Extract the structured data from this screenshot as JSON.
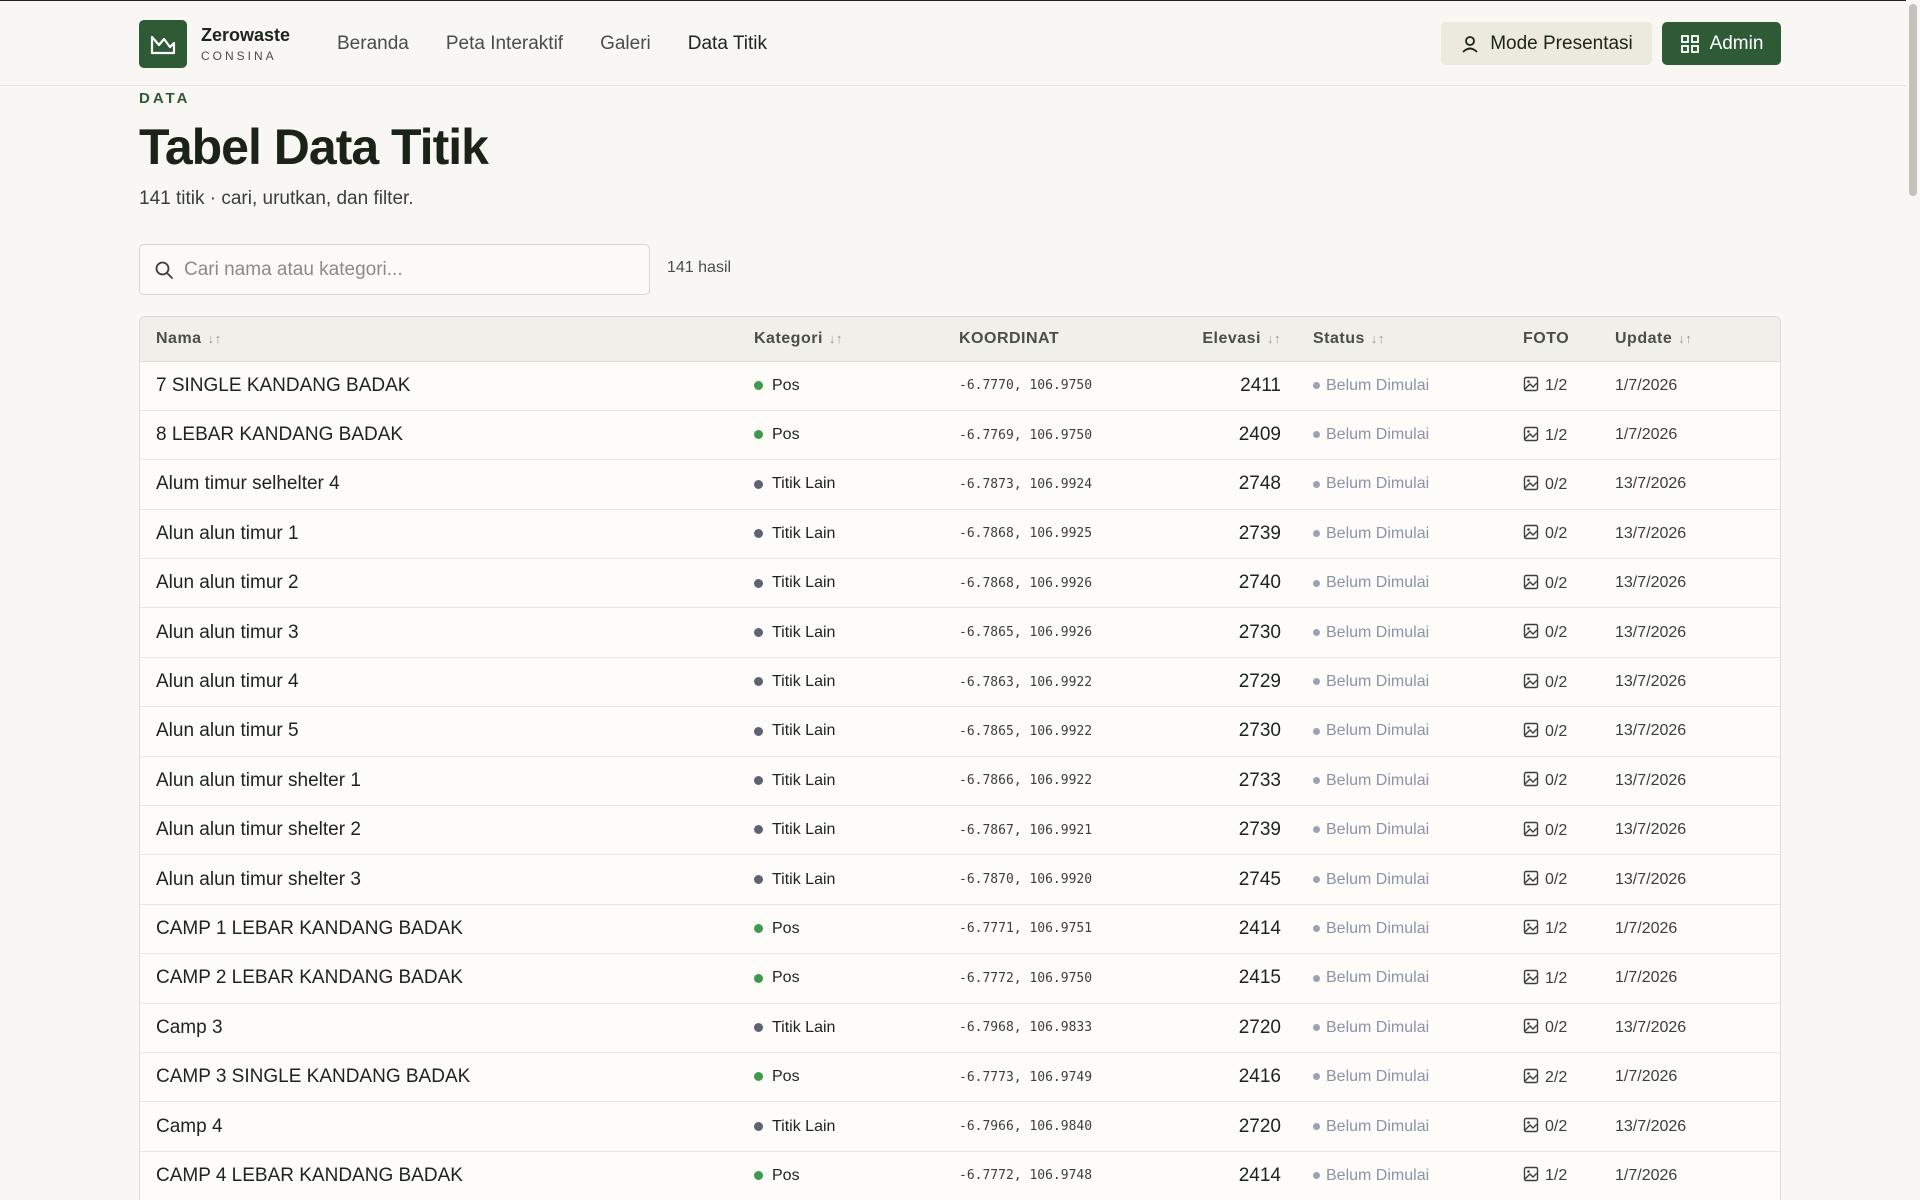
{
  "brand": {
    "name": "Zerowaste",
    "sub": "CONSINA"
  },
  "nav": {
    "items": [
      "Beranda",
      "Peta Interaktif",
      "Galeri",
      "Data Titik"
    ],
    "active": 3
  },
  "buttons": {
    "present": "Mode Presentasi",
    "admin": "Admin"
  },
  "header": {
    "eyebrow": "DATA",
    "title": "Tabel Data Titik",
    "subtitle": "141 titik · cari, urutkan, dan filter."
  },
  "search": {
    "placeholder": "Cari nama atau kategori...",
    "value": "",
    "result_count": "141 hasil"
  },
  "table": {
    "columns": [
      {
        "label": "Nama",
        "sortable": true
      },
      {
        "label": "Kategori",
        "sortable": true
      },
      {
        "label": "KOORDINAT",
        "sortable": false
      },
      {
        "label": "Elevasi",
        "sortable": true
      },
      {
        "label": "Status",
        "sortable": true
      },
      {
        "label": "FOTO",
        "sortable": false
      },
      {
        "label": "Update",
        "sortable": true
      }
    ],
    "rows": [
      {
        "nama": "7 SINGLE KANDANG BADAK",
        "kategori": "Pos",
        "koordinat": "-6.7770, 106.9750",
        "elevasi": "2411",
        "status": "Belum Dimulai",
        "foto": "1/2",
        "update": "1/7/2026"
      },
      {
        "nama": "8 LEBAR KANDANG BADAK",
        "kategori": "Pos",
        "koordinat": "-6.7769, 106.9750",
        "elevasi": "2409",
        "status": "Belum Dimulai",
        "foto": "1/2",
        "update": "1/7/2026"
      },
      {
        "nama": "Alum timur selhelter 4",
        "kategori": "Titik Lain",
        "koordinat": "-6.7873, 106.9924",
        "elevasi": "2748",
        "status": "Belum Dimulai",
        "foto": "0/2",
        "update": "13/7/2026"
      },
      {
        "nama": "Alun alun timur 1",
        "kategori": "Titik Lain",
        "koordinat": "-6.7868, 106.9925",
        "elevasi": "2739",
        "status": "Belum Dimulai",
        "foto": "0/2",
        "update": "13/7/2026"
      },
      {
        "nama": "Alun alun timur 2",
        "kategori": "Titik Lain",
        "koordinat": "-6.7868, 106.9926",
        "elevasi": "2740",
        "status": "Belum Dimulai",
        "foto": "0/2",
        "update": "13/7/2026"
      },
      {
        "nama": "Alun alun timur 3",
        "kategori": "Titik Lain",
        "koordinat": "-6.7865, 106.9926",
        "elevasi": "2730",
        "status": "Belum Dimulai",
        "foto": "0/2",
        "update": "13/7/2026"
      },
      {
        "nama": "Alun alun timur 4",
        "kategori": "Titik Lain",
        "koordinat": "-6.7863, 106.9922",
        "elevasi": "2729",
        "status": "Belum Dimulai",
        "foto": "0/2",
        "update": "13/7/2026"
      },
      {
        "nama": "Alun alun timur 5",
        "kategori": "Titik Lain",
        "koordinat": "-6.7865, 106.9922",
        "elevasi": "2730",
        "status": "Belum Dimulai",
        "foto": "0/2",
        "update": "13/7/2026"
      },
      {
        "nama": "Alun alun timur shelter 1",
        "kategori": "Titik Lain",
        "koordinat": "-6.7866, 106.9922",
        "elevasi": "2733",
        "status": "Belum Dimulai",
        "foto": "0/2",
        "update": "13/7/2026"
      },
      {
        "nama": "Alun alun timur shelter 2",
        "kategori": "Titik Lain",
        "koordinat": "-6.7867, 106.9921",
        "elevasi": "2739",
        "status": "Belum Dimulai",
        "foto": "0/2",
        "update": "13/7/2026"
      },
      {
        "nama": "Alun alun timur shelter 3",
        "kategori": "Titik Lain",
        "koordinat": "-6.7870, 106.9920",
        "elevasi": "2745",
        "status": "Belum Dimulai",
        "foto": "0/2",
        "update": "13/7/2026"
      },
      {
        "nama": "CAMP 1 LEBAR KANDANG BADAK",
        "kategori": "Pos",
        "koordinat": "-6.7771, 106.9751",
        "elevasi": "2414",
        "status": "Belum Dimulai",
        "foto": "1/2",
        "update": "1/7/2026"
      },
      {
        "nama": "CAMP 2 LEBAR KANDANG BADAK",
        "kategori": "Pos",
        "koordinat": "-6.7772, 106.9750",
        "elevasi": "2415",
        "status": "Belum Dimulai",
        "foto": "1/2",
        "update": "1/7/2026"
      },
      {
        "nama": "Camp 3",
        "kategori": "Titik Lain",
        "koordinat": "-6.7968, 106.9833",
        "elevasi": "2720",
        "status": "Belum Dimulai",
        "foto": "0/2",
        "update": "13/7/2026"
      },
      {
        "nama": "CAMP 3 SINGLE KANDANG BADAK",
        "kategori": "Pos",
        "koordinat": "-6.7773, 106.9749",
        "elevasi": "2416",
        "status": "Belum Dimulai",
        "foto": "2/2",
        "update": "1/7/2026"
      },
      {
        "nama": "Camp 4",
        "kategori": "Titik Lain",
        "koordinat": "-6.7966, 106.9840",
        "elevasi": "2720",
        "status": "Belum Dimulai",
        "foto": "0/2",
        "update": "13/7/2026"
      },
      {
        "nama": "CAMP 4 LEBAR KANDANG BADAK",
        "kategori": "Pos",
        "koordinat": "-6.7772, 106.9748",
        "elevasi": "2414",
        "status": "Belum Dimulai",
        "foto": "1/2",
        "update": "1/7/2026"
      }
    ]
  },
  "colors": {
    "accent": "#2e5a36",
    "pos": "#3f9a4d",
    "titik_lain": "#5c6473",
    "status": "#9aa3b5"
  }
}
